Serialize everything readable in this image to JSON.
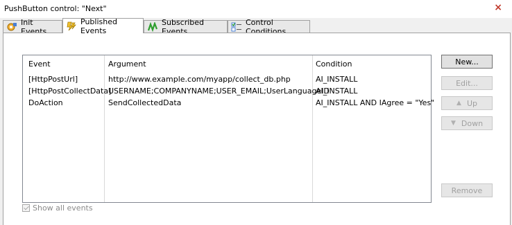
{
  "window": {
    "title": "PushButton control: \"Next\"",
    "close_glyph": "×"
  },
  "tabs": [
    {
      "label": "Init Events",
      "icon": "gear-events-icon"
    },
    {
      "label": "Published Events",
      "icon": "lightning-icon"
    },
    {
      "label": "Subscribed Events",
      "icon": "green-squiggle-icon"
    },
    {
      "label": "Control Conditions",
      "icon": "checklist-icon"
    }
  ],
  "active_tab": 1,
  "table": {
    "headers": [
      "Event",
      "Argument",
      "Condition"
    ],
    "rows": [
      {
        "event": "[HttpPostUrl]",
        "argument": "http://www.example.com/myapp/collect_db.php",
        "condition": "AI_INSTALL"
      },
      {
        "event": "[HttpPostCollectData]",
        "argument": "USERNAME;COMPANYNAME;USER_EMAIL;UserLanguageID",
        "condition": "AI_INSTALL"
      },
      {
        "event": "DoAction",
        "argument": "SendCollectedData",
        "condition": "AI_INSTALL AND IAgree = \"Yes\""
      }
    ]
  },
  "buttons": {
    "new": "New...",
    "edit": "Edit...",
    "up": "Up",
    "down": "Down",
    "remove": "Remove"
  },
  "show_all_events": {
    "label": "Show all events",
    "checked": true,
    "enabled": false
  },
  "colors": {
    "accent_close": "#c0392b",
    "disabled_text": "#a0a0a0"
  }
}
